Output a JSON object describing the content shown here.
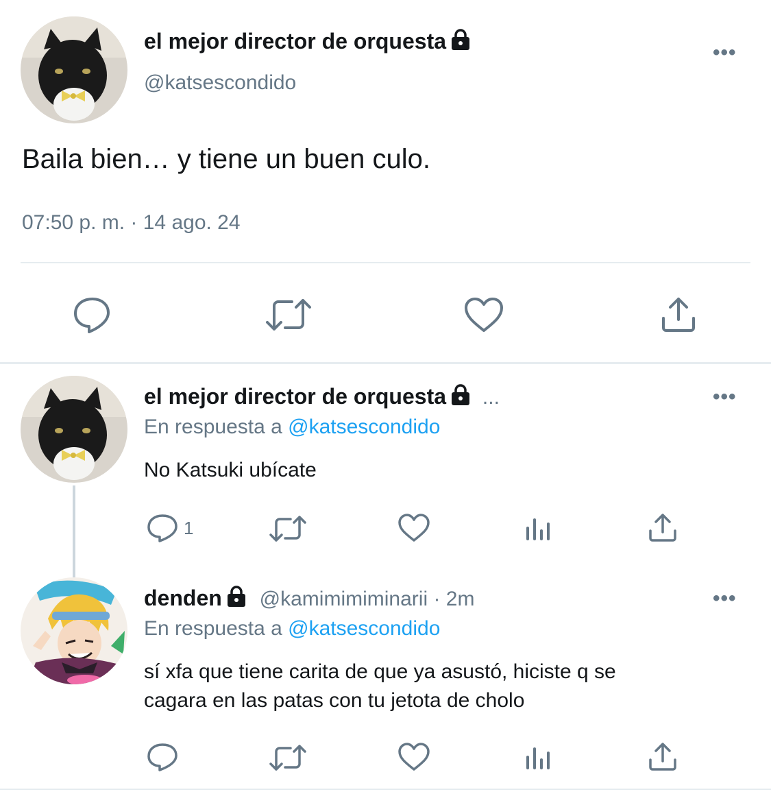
{
  "main_tweet": {
    "display_name": "el mejor director de orquesta",
    "handle": "@katsescondido",
    "text": "Baila bien… y tiene un buen culo.",
    "timestamp": "07:50 p. m. · 14 ago. 24",
    "more_label": "•••"
  },
  "reply1": {
    "display_name": "el mejor director de orquesta",
    "ellipsis": "...",
    "reply_prefix": "En respuesta a",
    "reply_mention": "@katsescondido",
    "text": "No Katsuki ubícate",
    "reply_count": "1",
    "more_label": "•••"
  },
  "reply2": {
    "display_name": "denden",
    "handle_time": "@kamimimiminarii · 2m",
    "reply_prefix": "En respuesta a",
    "reply_mention": "@katsescondido",
    "text_line1": "sí xfa que tiene carita de que ya asustó, hiciste q se",
    "text_line2": "cagara en las patas con tu jetota de cholo",
    "more_label": "•••"
  },
  "colors": {
    "text": "#14171a",
    "secondary": "#657786",
    "accent": "#1da1f2",
    "divider": "#e6ecf0"
  },
  "icons": [
    "reply-icon",
    "retweet-icon",
    "like-icon",
    "share-icon",
    "analytics-icon",
    "lock-icon",
    "more-icon"
  ]
}
